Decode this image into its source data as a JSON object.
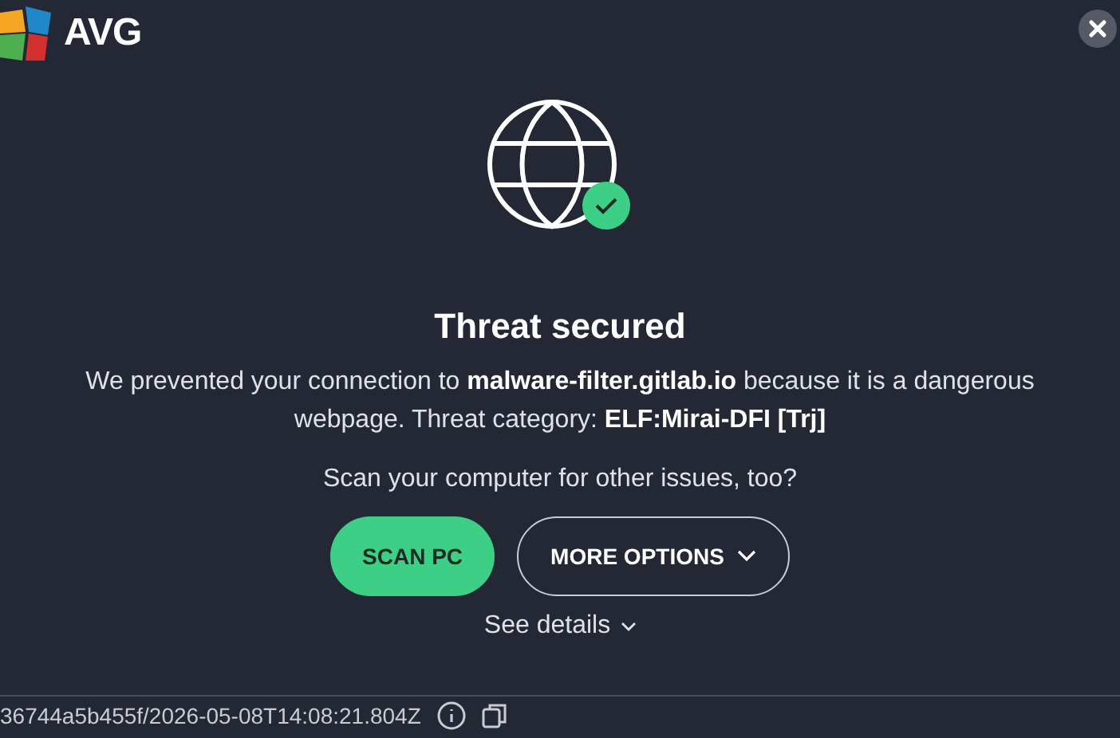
{
  "header": {
    "logo": "AVG"
  },
  "alert": {
    "title": "Threat secured",
    "message": "We prevented your connection to **malware-filter.gitlab.io** because it is a dangerous webpage. Threat category: **ELF:Mirai-DFI [Trj]**",
    "prompt": "Scan your computer for other issues, too?"
  },
  "buttons": [
    {
      "kind": "primary",
      "label": "SCAN PC"
    },
    {
      "kind": "dropdown",
      "label": "MORE OPTIONS"
    }
  ],
  "details_link": "See details",
  "footer": {
    "id": "36744a5b455f/2026-05-08T14:08:21.804Z"
  }
}
